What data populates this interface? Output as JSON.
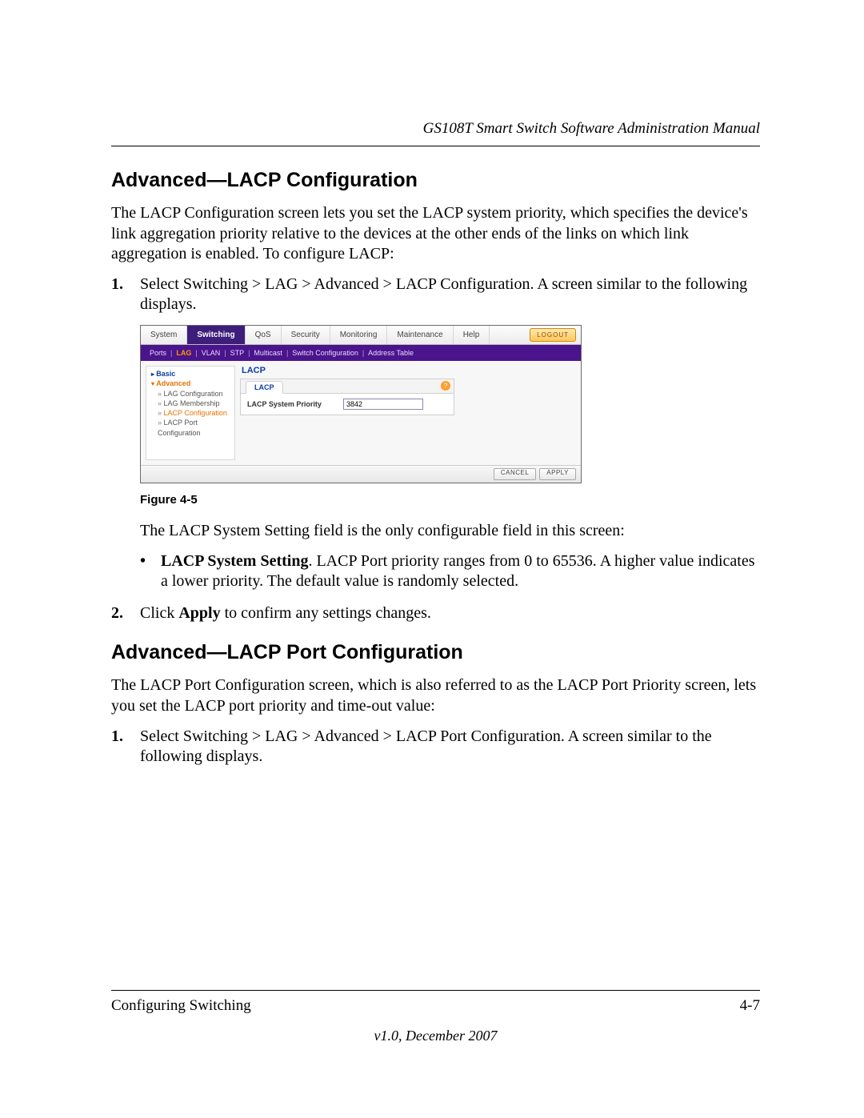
{
  "header": {
    "running": "GS108T Smart Switch Software Administration Manual"
  },
  "section1": {
    "title": "Advanced—LACP Configuration",
    "intro": "The LACP Configuration screen lets you set the LACP system priority, which specifies the device's link aggregation priority relative to the devices at the other ends of the links on which link aggregation is enabled. To configure LACP:",
    "step1_num": "1.",
    "step1": "Select Switching > LAG > Advanced > LACP Configuration. A screen similar to the following displays.",
    "fig_caption": "Figure 4-5",
    "after_fig": "The LACP System Setting field is the only configurable field in this screen:",
    "bullet_lead": "LACP System Setting",
    "bullet_rest": ". LACP Port priority ranges from 0 to 65536. A higher value indicates a lower priority. The default value is randomly selected.",
    "step2_num": "2.",
    "step2_a": "Click ",
    "step2_b": "Apply",
    "step2_c": " to confirm any settings changes."
  },
  "section2": {
    "title": "Advanced—LACP Port Configuration",
    "intro": "The LACP Port Configuration screen, which is also referred to as the LACP Port Priority screen, lets you set the LACP port priority and time-out value:",
    "step1_num": "1.",
    "step1": "Select Switching > LAG > Advanced > LACP Port Configuration. A screen similar to the following displays."
  },
  "footer": {
    "left": "Configuring Switching",
    "right": "4-7",
    "version": "v1.0, December 2007"
  },
  "ui": {
    "tabs": [
      "System",
      "Switching",
      "QoS",
      "Security",
      "Monitoring",
      "Maintenance",
      "Help"
    ],
    "logout": "LOGOUT",
    "subnav": [
      "Ports",
      "LAG",
      "VLAN",
      "STP",
      "Multicast",
      "Switch Configuration",
      "Address Table"
    ],
    "subnav_selected": "LAG",
    "side": {
      "basic": "Basic",
      "advanced": "Advanced",
      "items": [
        "LAG Configuration",
        "LAG Membership",
        "LACP Configuration",
        "LACP Port Configuration"
      ],
      "selected": "LACP Configuration"
    },
    "panel": {
      "title": "LACP",
      "tab": "LACP",
      "field_label": "LACP System Priority",
      "field_value": "3842",
      "help": "?"
    },
    "buttons": {
      "cancel": "CANCEL",
      "apply": "APPLY"
    }
  }
}
